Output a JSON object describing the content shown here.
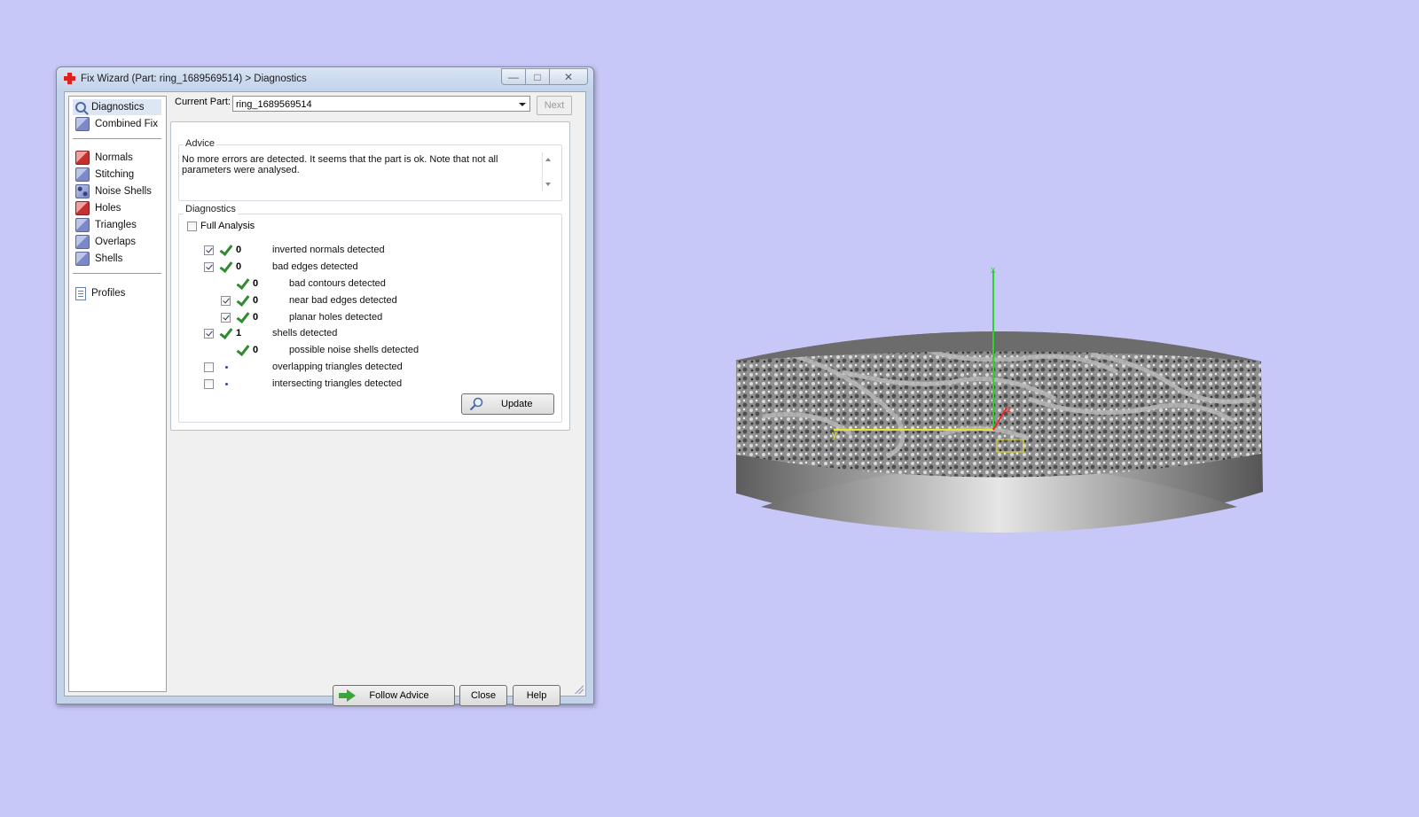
{
  "window": {
    "title": "Fix Wizard (Part: ring_1689569514) > Diagnostics",
    "controls": {
      "minimize": "—",
      "maximize": "□",
      "close": "✕"
    }
  },
  "sidebar": {
    "items": [
      {
        "label": "Diagnostics",
        "icon": "magnifier-icon",
        "selected": true
      },
      {
        "label": "Combined Fix",
        "icon": "combined-fix-icon"
      },
      {
        "label": "Normals",
        "icon": "normals-icon"
      },
      {
        "label": "Stitching",
        "icon": "stitching-icon"
      },
      {
        "label": "Noise Shells",
        "icon": "noise-shells-icon"
      },
      {
        "label": "Holes",
        "icon": "holes-icon"
      },
      {
        "label": "Triangles",
        "icon": "triangles-icon"
      },
      {
        "label": "Overlaps",
        "icon": "overlaps-icon"
      },
      {
        "label": "Shells",
        "icon": "shells-icon"
      },
      {
        "label": "Profiles",
        "icon": "profiles-icon"
      }
    ]
  },
  "header": {
    "current_part_label": "Current Part:",
    "current_part_value": "ring_1689569514",
    "next_label": "Next"
  },
  "advice": {
    "title": "Advice",
    "text": "No more errors are detected. It seems that the part is ok. Note that not all parameters were analysed."
  },
  "diagnostics": {
    "title": "Diagnostics",
    "full_analysis_label": "Full Analysis",
    "full_analysis_checked": false,
    "rows": [
      {
        "label": "inverted normals detected",
        "count": "0",
        "checked": true,
        "status": "ok"
      },
      {
        "label": "bad edges detected",
        "count": "0",
        "checked": true,
        "status": "ok"
      },
      {
        "label": "bad contours detected",
        "count": "0",
        "status": "ok"
      },
      {
        "label": "near bad edges detected",
        "count": "0",
        "checked": true,
        "status": "ok"
      },
      {
        "label": "planar holes detected",
        "count": "0",
        "checked": true,
        "status": "ok"
      },
      {
        "label": "shells detected",
        "count": "1",
        "checked": true,
        "status": "ok"
      },
      {
        "label": "possible noise shells detected",
        "count": "0",
        "status": "ok"
      },
      {
        "label": "overlapping triangles detected",
        "checked": false,
        "status": "pending"
      },
      {
        "label": "intersecting triangles detected",
        "checked": false,
        "status": "pending"
      }
    ],
    "update_label": "Update"
  },
  "footer": {
    "follow_advice_label": "Follow Advice",
    "close_label": "Close",
    "help_label": "Help"
  },
  "viewport": {
    "axis_x_label": "x",
    "axis_y_label": "y",
    "axis_z_label": "z",
    "colors": {
      "background": "#c8c8f8",
      "x_axis": "#2bd42b",
      "y_axis": "#e5e52a",
      "z_axis": "#e52a2a"
    }
  }
}
